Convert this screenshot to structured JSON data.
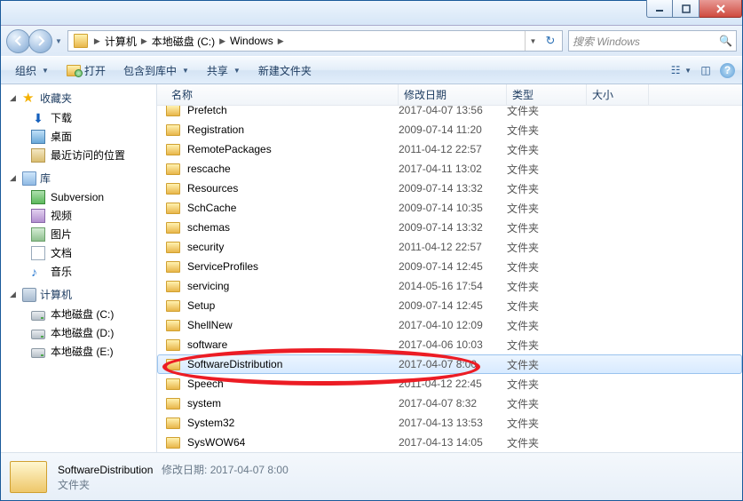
{
  "window": {
    "breadcrumb": {
      "root": "计算机",
      "drive": "本地磁盘 (C:)",
      "folder": "Windows"
    },
    "search_placeholder": "搜索 Windows"
  },
  "toolbar": {
    "organize": "组织",
    "open": "打开",
    "include": "包含到库中",
    "share": "共享",
    "newfolder": "新建文件夹"
  },
  "sidebar": {
    "favorites": "收藏夹",
    "fav_items": [
      "下载",
      "桌面",
      "最近访问的位置"
    ],
    "libraries": "库",
    "lib_items": [
      "Subversion",
      "视频",
      "图片",
      "文档",
      "音乐"
    ],
    "computer": "计算机",
    "drives": [
      "本地磁盘 (C:)",
      "本地磁盘 (D:)",
      "本地磁盘 (E:)"
    ]
  },
  "columns": {
    "name": "名称",
    "date": "修改日期",
    "type": "类型",
    "size": "大小"
  },
  "type_folder": "文件夹",
  "rows": [
    {
      "n": "Prefetch",
      "d": "2017-04-07 13:56"
    },
    {
      "n": "Registration",
      "d": "2009-07-14 11:20"
    },
    {
      "n": "RemotePackages",
      "d": "2011-04-12 22:57"
    },
    {
      "n": "rescache",
      "d": "2017-04-11 13:02"
    },
    {
      "n": "Resources",
      "d": "2009-07-14 13:32"
    },
    {
      "n": "SchCache",
      "d": "2009-07-14 10:35"
    },
    {
      "n": "schemas",
      "d": "2009-07-14 13:32"
    },
    {
      "n": "security",
      "d": "2011-04-12 22:57"
    },
    {
      "n": "ServiceProfiles",
      "d": "2009-07-14 12:45"
    },
    {
      "n": "servicing",
      "d": "2014-05-16 17:54"
    },
    {
      "n": "Setup",
      "d": "2009-07-14 12:45"
    },
    {
      "n": "ShellNew",
      "d": "2017-04-10 12:09"
    },
    {
      "n": "software",
      "d": "2017-04-06 10:03"
    },
    {
      "n": "SoftwareDistribution",
      "d": "2017-04-07 8:00",
      "sel": true
    },
    {
      "n": "Speech",
      "d": "2011-04-12 22:45"
    },
    {
      "n": "system",
      "d": "2017-04-07 8:32"
    },
    {
      "n": "System32",
      "d": "2017-04-13 13:53"
    },
    {
      "n": "SysWOW64",
      "d": "2017-04-13 14:05"
    }
  ],
  "details": {
    "name": "SoftwareDistribution",
    "date_label": "修改日期:",
    "date": "2017-04-07 8:00",
    "type": "文件夹"
  }
}
